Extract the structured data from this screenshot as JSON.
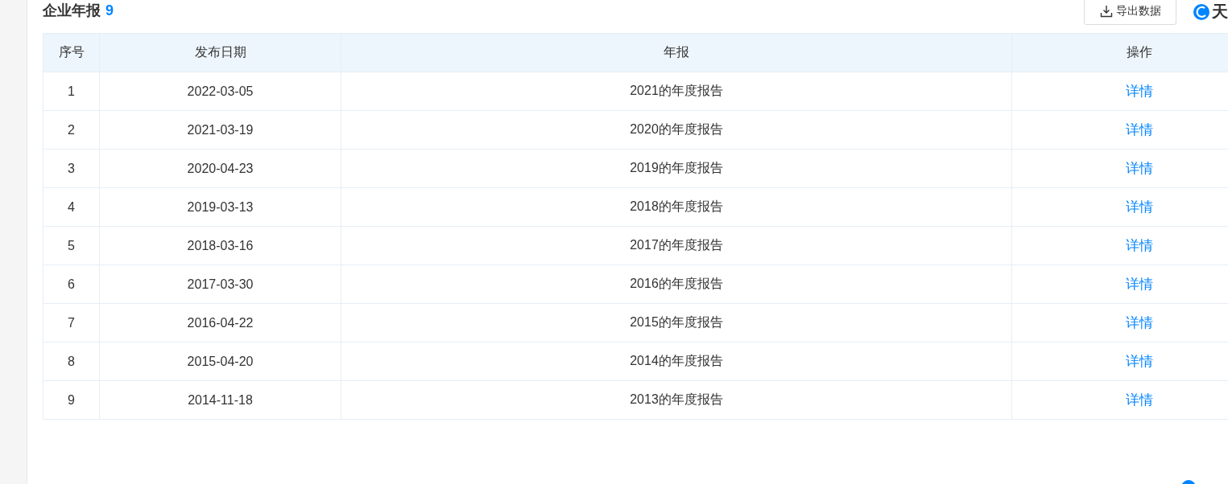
{
  "section": {
    "title": "企业年报",
    "count": "9"
  },
  "export_button": {
    "label": "导出数据"
  },
  "logo": {
    "text": "天"
  },
  "table": {
    "columns": [
      "序号",
      "发布日期",
      "年报",
      "操作"
    ],
    "rows": [
      {
        "index": "1",
        "date": "2022-03-05",
        "report": "2021的年度报告",
        "action": "详情"
      },
      {
        "index": "2",
        "date": "2021-03-19",
        "report": "2020的年度报告",
        "action": "详情"
      },
      {
        "index": "3",
        "date": "2020-04-23",
        "report": "2019的年度报告",
        "action": "详情"
      },
      {
        "index": "4",
        "date": "2019-03-13",
        "report": "2018的年度报告",
        "action": "详情"
      },
      {
        "index": "5",
        "date": "2018-03-16",
        "report": "2017的年度报告",
        "action": "详情"
      },
      {
        "index": "6",
        "date": "2017-03-30",
        "report": "2016的年度报告",
        "action": "详情"
      },
      {
        "index": "7",
        "date": "2016-04-22",
        "report": "2015的年度报告",
        "action": "详情"
      },
      {
        "index": "8",
        "date": "2015-04-20",
        "report": "2014的年度报告",
        "action": "详情"
      },
      {
        "index": "9",
        "date": "2014-11-18",
        "report": "2013的年度报告",
        "action": "详情"
      }
    ]
  }
}
